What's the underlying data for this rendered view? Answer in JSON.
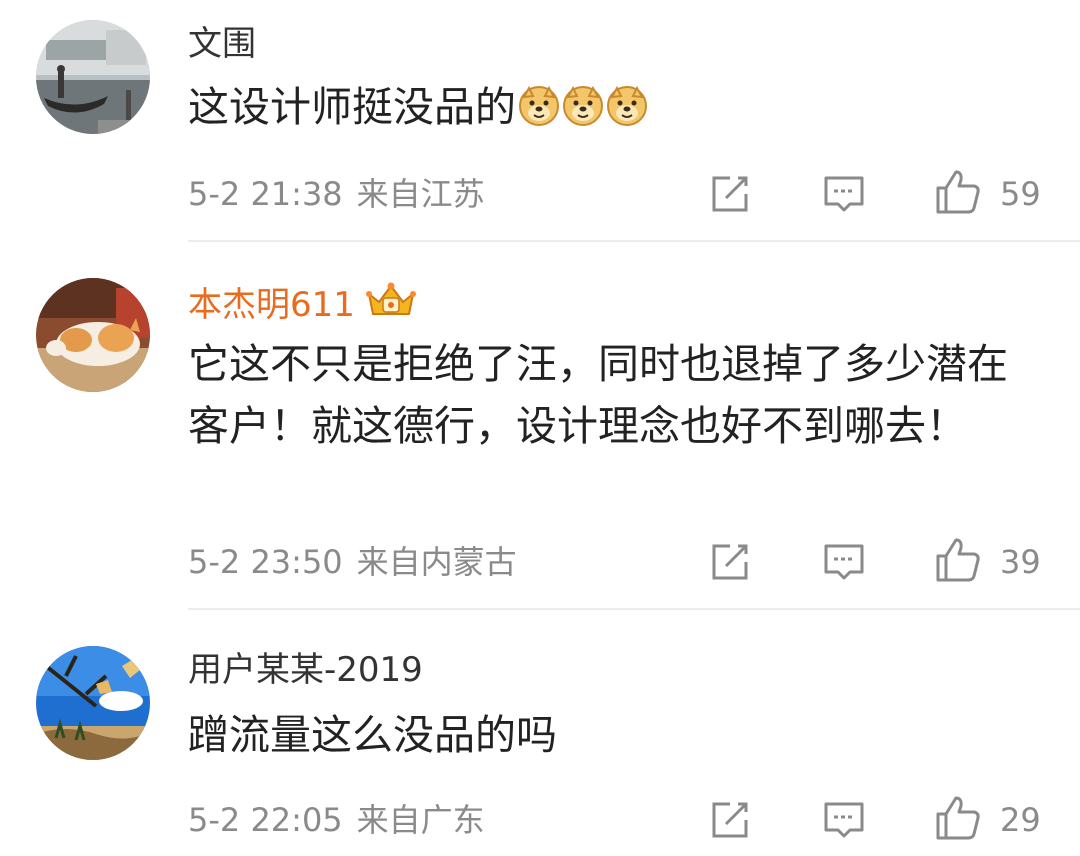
{
  "comments": [
    {
      "username": "文围",
      "text": "这设计师挺没品的",
      "emoji_count": 3,
      "emoji_icon": "doge-emoji-icon",
      "time": "5-2 21:38",
      "location": "来自江苏",
      "likes": "59",
      "vip": false
    },
    {
      "username": "本杰明611",
      "text": "它这不只是拒绝了汪，同时也退掉了多少潜在客户！就这德行，设计理念也好不到哪去！",
      "time": "5-2 23:50",
      "location": "来自内蒙古",
      "likes": "39",
      "vip": true,
      "badge_icon": "vip-crown-icon"
    },
    {
      "username": "用户某某-2019",
      "text": "蹭流量这么没品的吗",
      "time": "5-2 22:05",
      "location": "来自广东",
      "likes": "29",
      "vip": false
    }
  ],
  "icons": {
    "share": "share-icon",
    "reply": "comment-icon",
    "like": "thumbs-up-icon"
  },
  "colors": {
    "vip_name": "#e86b1f",
    "meta_text": "#8a8a8a",
    "body_text": "#222222"
  }
}
